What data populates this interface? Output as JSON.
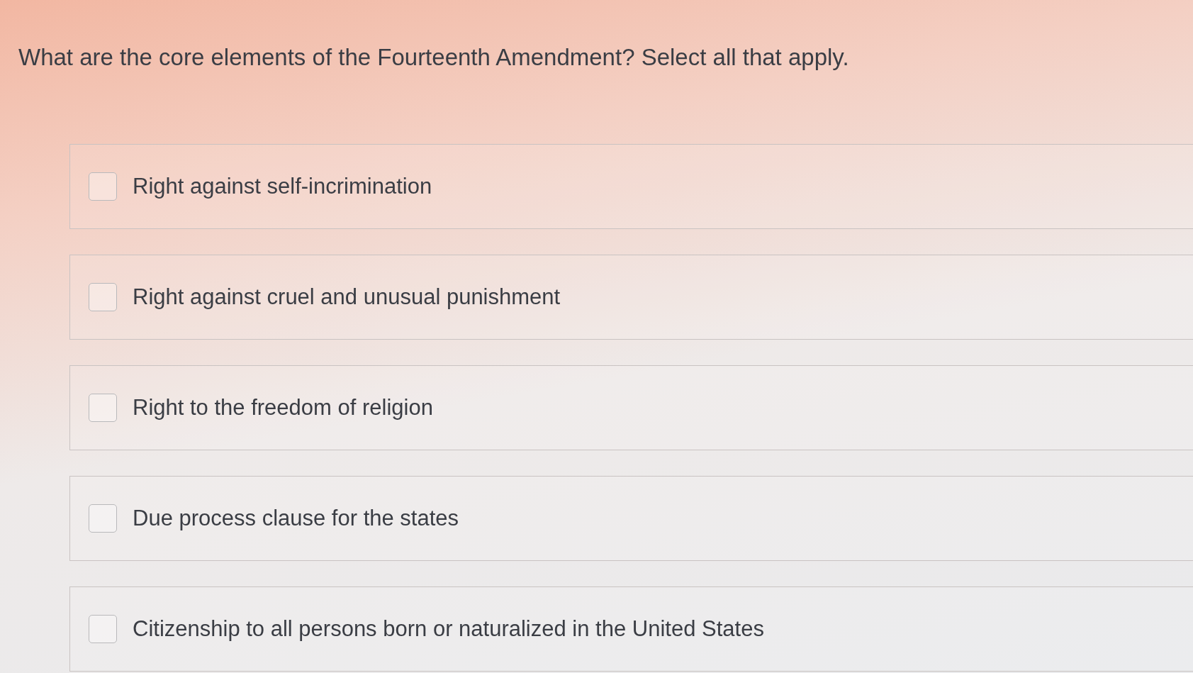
{
  "question": "What are the core elements of the Fourteenth Amendment? Select all that apply.",
  "options": [
    {
      "label": "Right against self-incrimination",
      "checked": false
    },
    {
      "label": "Right against cruel and unusual punishment",
      "checked": false
    },
    {
      "label": "Right to the freedom of religion",
      "checked": false
    },
    {
      "label": "Due process clause for the states",
      "checked": false
    },
    {
      "label": "Citizenship to all persons born or naturalized in the United States",
      "checked": false
    }
  ]
}
